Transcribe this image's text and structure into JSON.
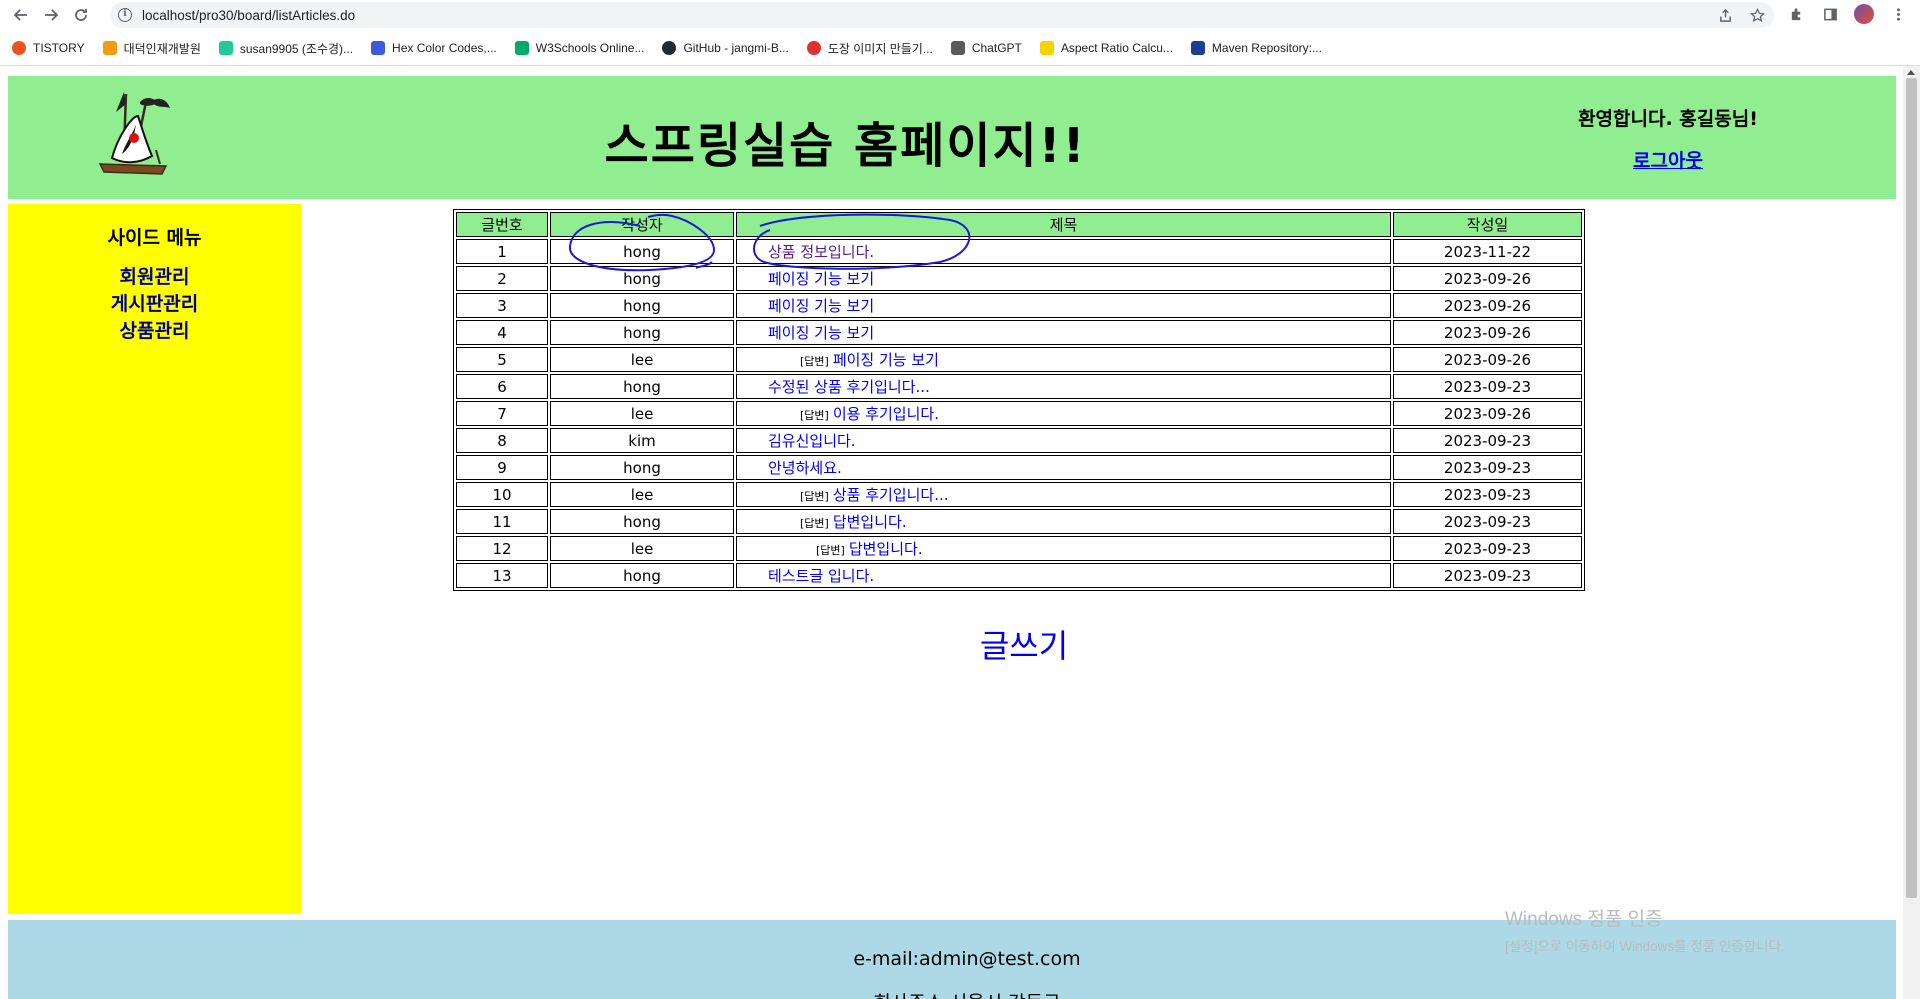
{
  "browser": {
    "url": "localhost/pro30/board/listArticles.do",
    "bookmarks": [
      {
        "label": "TISTORY",
        "icon": "tistory-icon",
        "color": "#eb531f"
      },
      {
        "label": "대덕인재개발원",
        "icon": "daedeok-icon",
        "color": "#f39c12"
      },
      {
        "label": "susan9905 (조수경)...",
        "icon": "velog-icon",
        "color": "#20c997"
      },
      {
        "label": "Hex Color Codes,...",
        "icon": "hexcolor-icon",
        "color": "#3b5bdb"
      },
      {
        "label": "W3Schools Online...",
        "icon": "w3schools-icon",
        "color": "#04aa6d"
      },
      {
        "label": "GitHub - jangmi-B...",
        "icon": "github-icon",
        "color": "#24292f"
      },
      {
        "label": "도장 이미지 만들기...",
        "icon": "stamp-icon",
        "color": "#e03131"
      },
      {
        "label": "ChatGPT",
        "icon": "chatgpt-icon",
        "color": "#5a5a5a"
      },
      {
        "label": "Aspect Ratio Calcu...",
        "icon": "aspect-ratio-icon",
        "color": "#f5d300"
      },
      {
        "label": "Maven Repository:...",
        "icon": "maven-icon",
        "color": "#1c3f95"
      }
    ]
  },
  "header": {
    "title": "스프링실습 홈페이지!!",
    "welcome": "환영합니다. 홍길동님!",
    "logout": "로그아웃"
  },
  "sidebar": {
    "title": "사이드 메뉴",
    "items": [
      {
        "label": "회원관리"
      },
      {
        "label": "게시판관리"
      },
      {
        "label": "상품관리"
      }
    ]
  },
  "table": {
    "headers": [
      "글번호",
      "작성자",
      "제목",
      "작성일"
    ],
    "rows": [
      {
        "no": "1",
        "writer": "hong",
        "title": "상품 정보입니다.",
        "date": "2023-11-22",
        "reply": false,
        "level": 0,
        "visited": true
      },
      {
        "no": "2",
        "writer": "hong",
        "title": "페이징 기능 보기",
        "date": "2023-09-26",
        "reply": false,
        "level": 0,
        "visited": false
      },
      {
        "no": "3",
        "writer": "hong",
        "title": "페이징 기능 보기",
        "date": "2023-09-26",
        "reply": false,
        "level": 0,
        "visited": false
      },
      {
        "no": "4",
        "writer": "hong",
        "title": "페이징 기능 보기",
        "date": "2023-09-26",
        "reply": false,
        "level": 0,
        "visited": false
      },
      {
        "no": "5",
        "writer": "lee",
        "title": "페이징 기능 보기",
        "date": "2023-09-26",
        "reply": true,
        "level": 1,
        "visited": false
      },
      {
        "no": "6",
        "writer": "hong",
        "title": "수정된 상품 후기입니다...",
        "date": "2023-09-23",
        "reply": false,
        "level": 0,
        "visited": false
      },
      {
        "no": "7",
        "writer": "lee",
        "title": "이용 후기입니다.",
        "date": "2023-09-26",
        "reply": true,
        "level": 1,
        "visited": false
      },
      {
        "no": "8",
        "writer": "kim",
        "title": "김유신입니다.",
        "date": "2023-09-23",
        "reply": false,
        "level": 0,
        "visited": false
      },
      {
        "no": "9",
        "writer": "hong",
        "title": "안녕하세요.",
        "date": "2023-09-23",
        "reply": false,
        "level": 0,
        "visited": false
      },
      {
        "no": "10",
        "writer": "lee",
        "title": "상품 후기입니다...",
        "date": "2023-09-23",
        "reply": true,
        "level": 1,
        "visited": false
      },
      {
        "no": "11",
        "writer": "hong",
        "title": "답변입니다.",
        "date": "2023-09-23",
        "reply": true,
        "level": 1,
        "visited": false
      },
      {
        "no": "12",
        "writer": "lee",
        "title": "답변입니다.",
        "date": "2023-09-23",
        "reply": true,
        "level": 2,
        "visited": false
      },
      {
        "no": "13",
        "writer": "hong",
        "title": "테스트글 입니다.",
        "date": "2023-09-23",
        "reply": false,
        "level": 0,
        "visited": false
      }
    ],
    "reply_tag": "[답변]"
  },
  "write_link": "글쓰기",
  "footer": {
    "email": "e-mail:admin@test.com",
    "address": "회사주소:서울시 강동구"
  },
  "windows_activation": {
    "line1": "Windows 정품 인증",
    "line2": "[설정]으로 이동하여 Windows를 정품 인증합니다."
  },
  "colors": {
    "header_bg": "#90ee90",
    "sidebar_bg": "#ffff00",
    "footer_bg": "#add8e6",
    "link": "#0000ee",
    "annotation": "#1a1ad6"
  }
}
